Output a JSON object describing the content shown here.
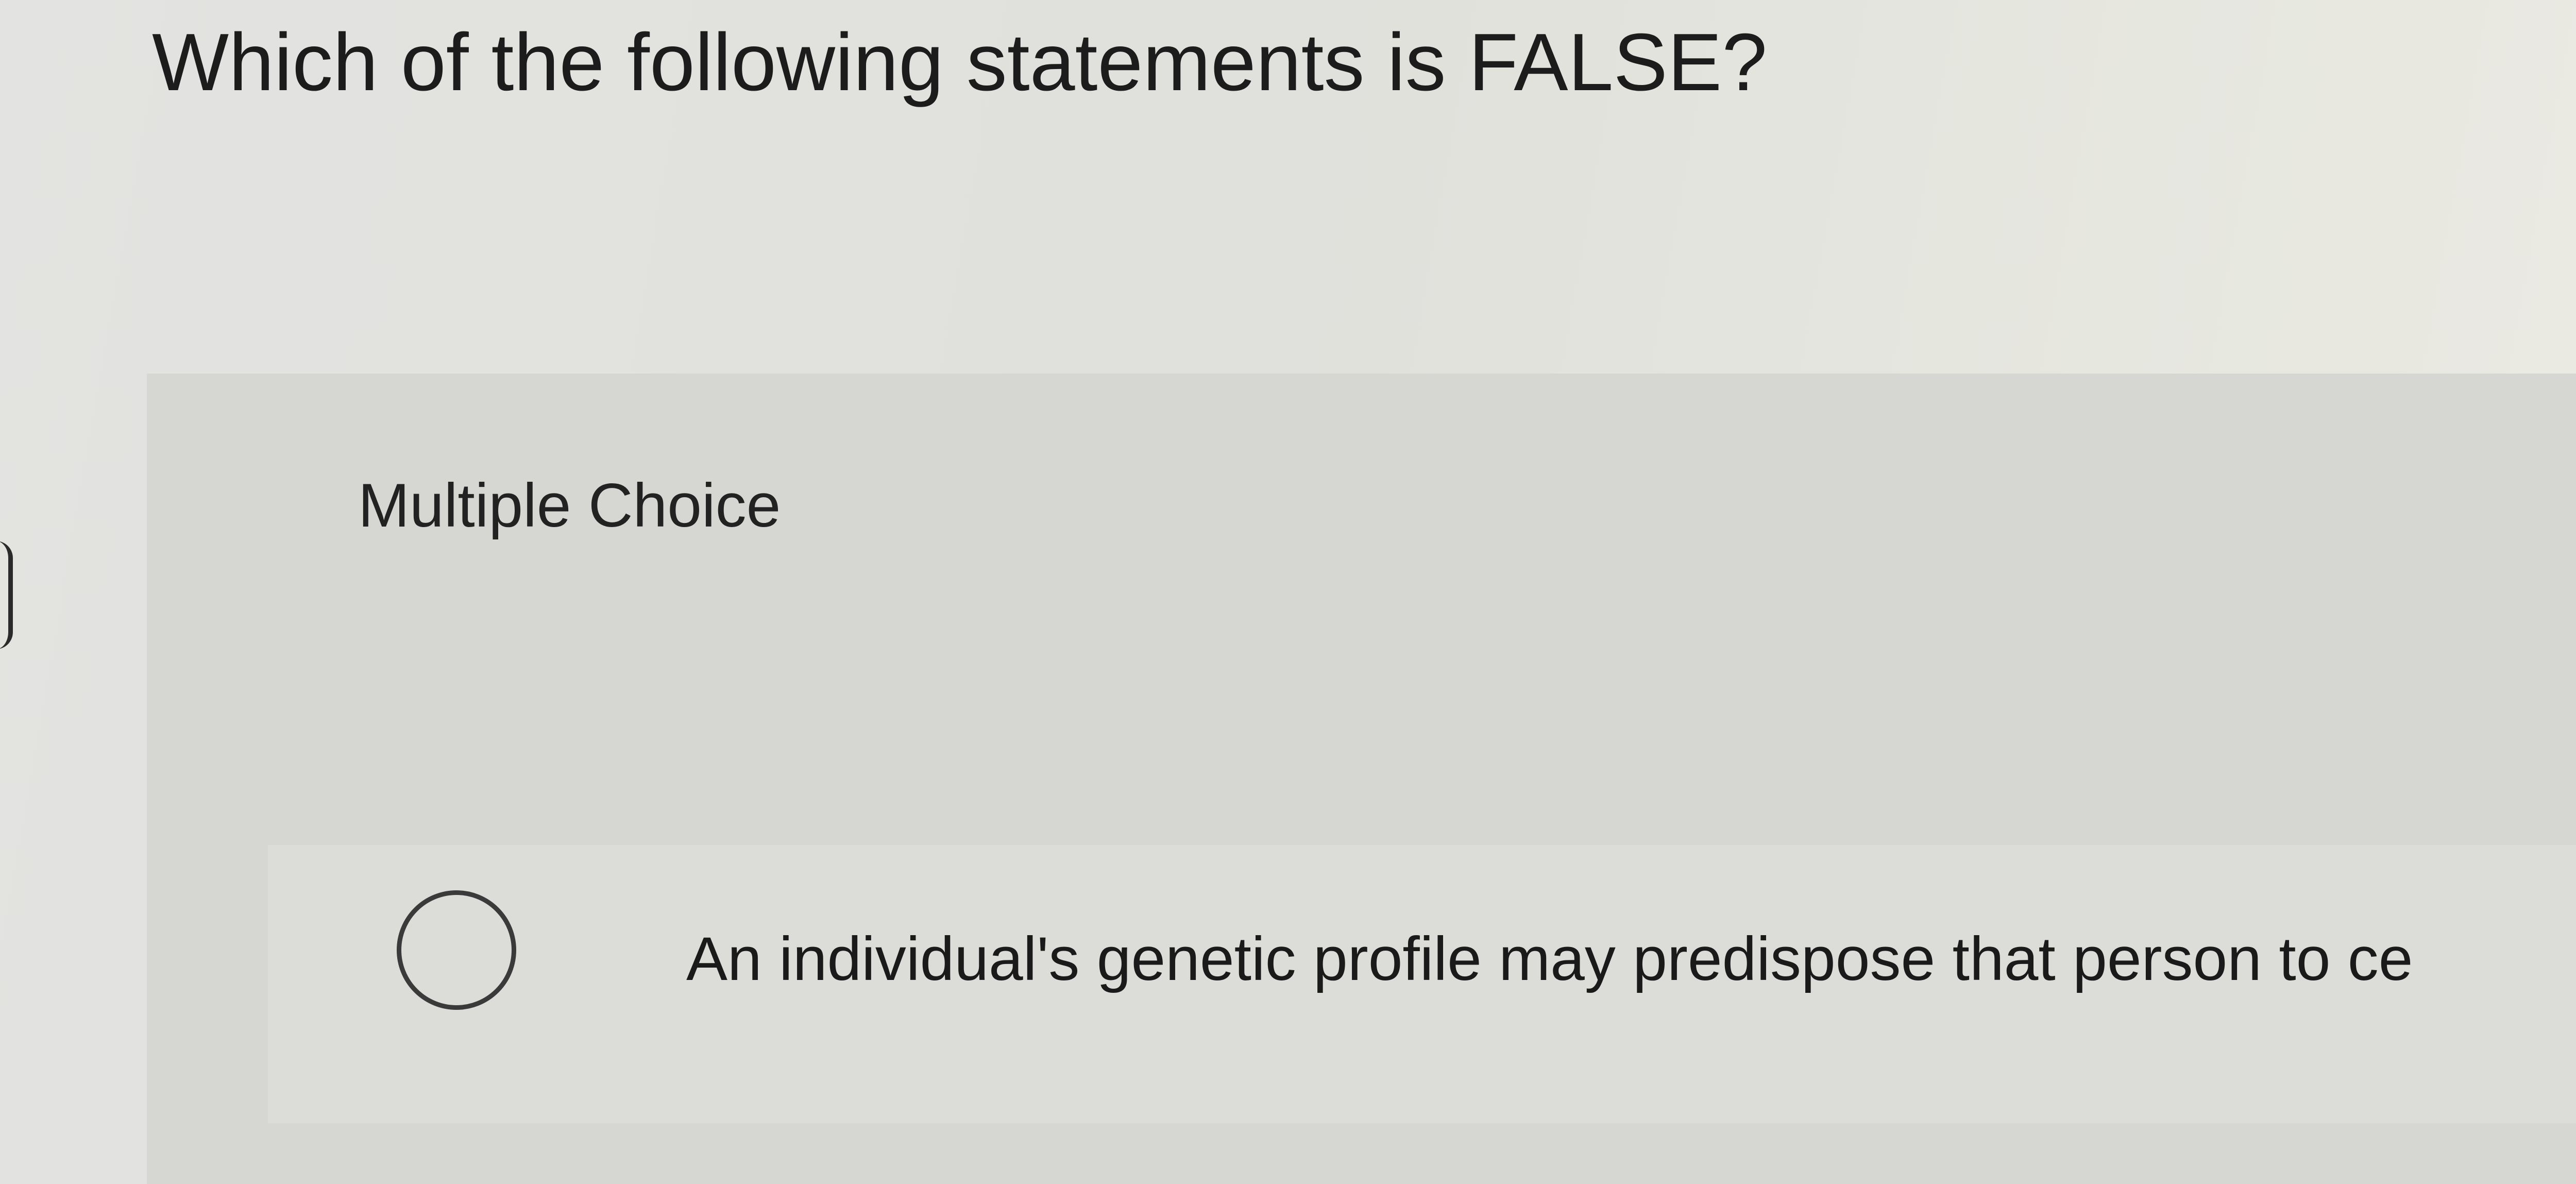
{
  "question": {
    "prompt": "Which of the following statements is FALSE?"
  },
  "answer_section": {
    "label": "Multiple Choice",
    "options": [
      {
        "selected": false,
        "text": "An individual's genetic profile may predispose that person to ce"
      }
    ]
  }
}
